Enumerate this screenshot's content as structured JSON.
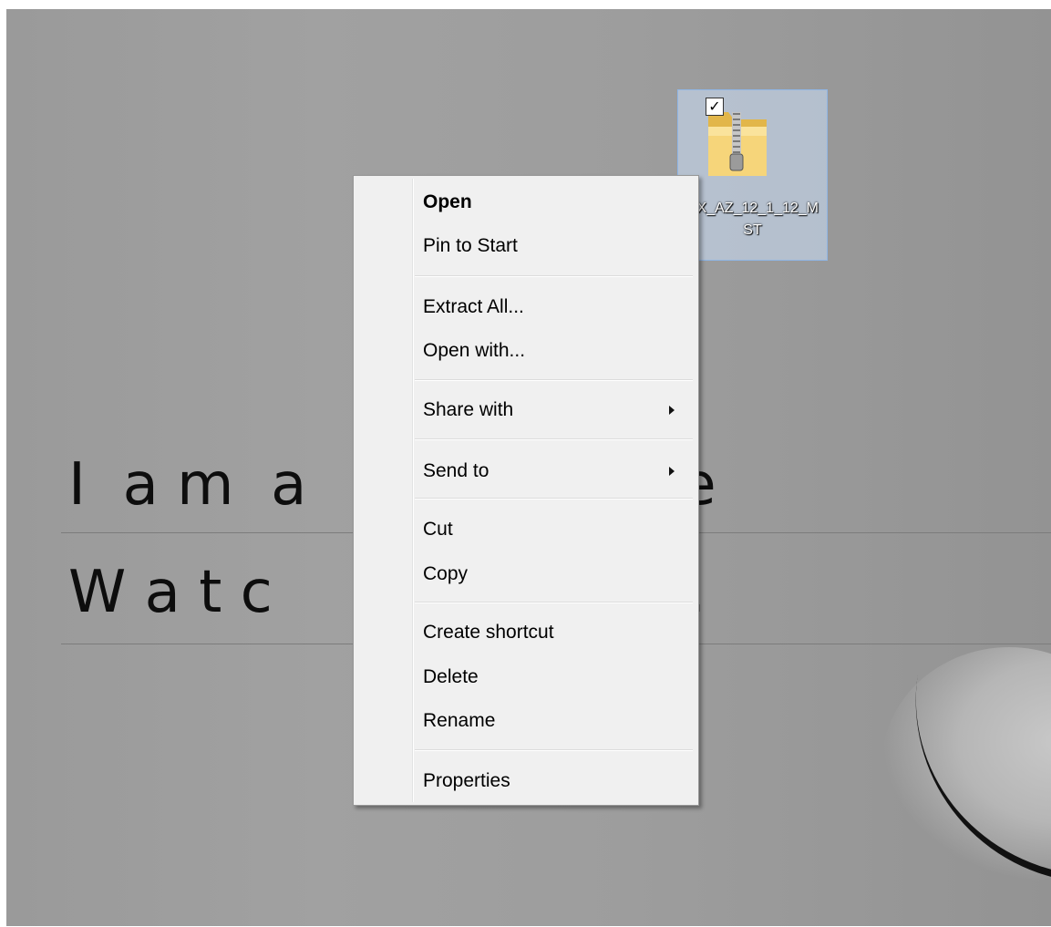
{
  "wallpaper": {
    "line1": "I  a m  a        o n  t h e",
    "line2": "W a t c          l  s o a r."
  },
  "desktop_icon": {
    "label": "HX_AZ_12_1_12_MST",
    "icon": "zip-folder-icon",
    "checked": true
  },
  "context_menu": {
    "items": [
      {
        "label": "Open"
      },
      {
        "label": "Pin to Start"
      },
      {
        "label": "Extract All..."
      },
      {
        "label": "Open with..."
      },
      {
        "label": "Share with"
      },
      {
        "label": "Send to"
      },
      {
        "label": "Cut"
      },
      {
        "label": "Copy"
      },
      {
        "label": "Create shortcut"
      },
      {
        "label": "Delete"
      },
      {
        "label": "Rename"
      },
      {
        "label": "Properties"
      }
    ]
  },
  "colors": {
    "menu_bg": "#f0f0f0",
    "selection_bg": "#cce0fa",
    "desktop_bg": "#9c9c9c"
  }
}
